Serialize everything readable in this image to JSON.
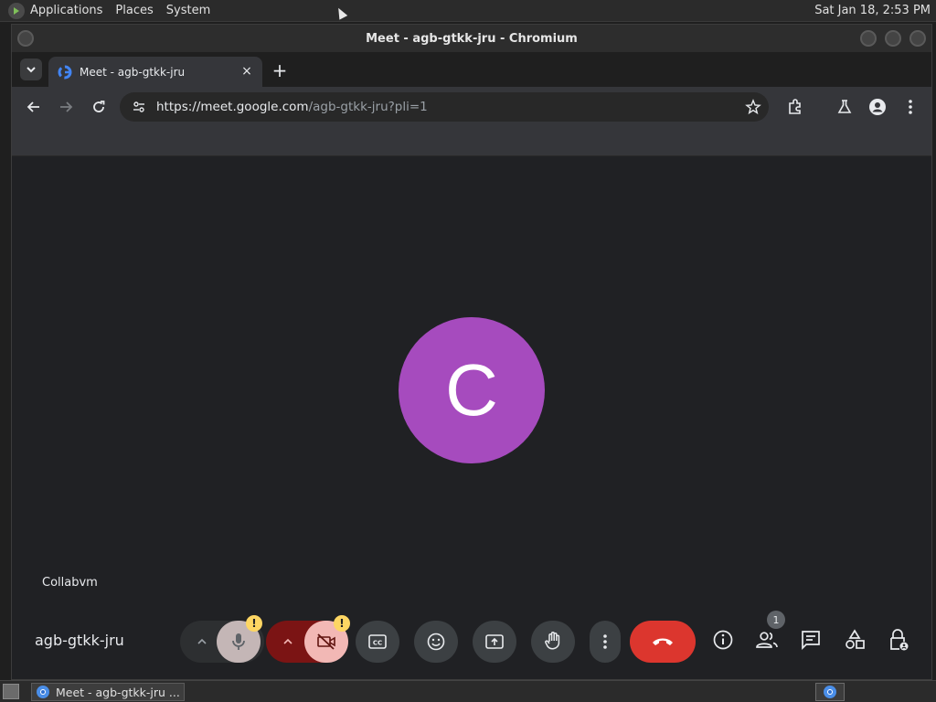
{
  "top_panel": {
    "menus": [
      "Applications",
      "Places",
      "System"
    ],
    "clock": "Sat Jan 18,  2:53 PM"
  },
  "window": {
    "title": "Meet - agb-gtkk-jru - Chromium"
  },
  "browser": {
    "tab_title": "Meet - agb-gtkk-jru",
    "new_tab_label": "+",
    "close_label": "×",
    "url_host": "https://meet.google.com",
    "url_path": "/agb-gtkk-jru?pli=1"
  },
  "meet": {
    "avatar_letter": "C",
    "self_name": "Collabvm",
    "meeting_code": "agb-gtkk-jru",
    "mic_warning": "!",
    "cam_warning": "!",
    "participants_count": "1",
    "colors": {
      "background": "#202124",
      "avatar": "#a64bbe",
      "end_call": "#dc362e",
      "warning": "#fdd663",
      "mic_off": "#c4b6b6",
      "cam_off": "#f2b8b5"
    }
  },
  "taskbar": {
    "task_label": "Meet - agb-gtkk-jru ..."
  }
}
